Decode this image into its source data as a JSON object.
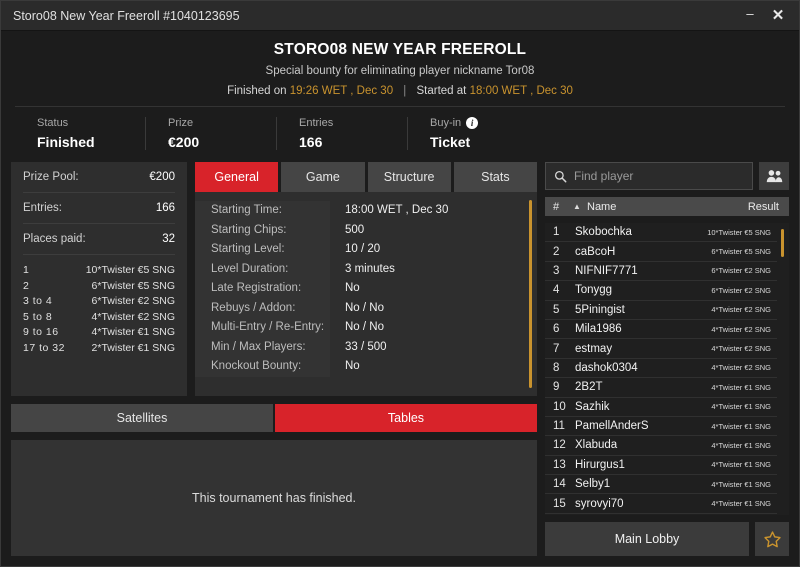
{
  "window": {
    "title": "Storo08 New Year Freeroll #1040123695",
    "minimize_label": "–",
    "close_label": "✕"
  },
  "header": {
    "title": "STORO08 NEW YEAR FREEROLL",
    "subtitle": "Special bounty for eliminating player nickname Tor08",
    "finished_label": "Finished on",
    "finished_value": "19:26 WET , Dec 30",
    "divider": "|",
    "started_label": "Started at",
    "started_value": "18:00 WET , Dec 30"
  },
  "stats": [
    {
      "label": "Status",
      "value": "Finished"
    },
    {
      "label": "Prize",
      "value": "€200"
    },
    {
      "label": "Entries",
      "value": "166"
    },
    {
      "label": "Buy-in",
      "value": "Ticket",
      "icon": "info-icon"
    }
  ],
  "prize_panel": {
    "rows": [
      {
        "label": "Prize Pool:",
        "value": "€200"
      },
      {
        "label": "Entries:",
        "value": "166"
      },
      {
        "label": "Places paid:",
        "value": "32"
      }
    ],
    "payouts": [
      {
        "place": "1",
        "prize": "10*Twister €5 SNG"
      },
      {
        "place": "2",
        "prize": "6*Twister €5 SNG"
      },
      {
        "place": "3  to  4",
        "prize": "6*Twister €2 SNG"
      },
      {
        "place": "5  to  8",
        "prize": "4*Twister €2 SNG"
      },
      {
        "place": "9  to  16",
        "prize": "4*Twister €1 SNG"
      },
      {
        "place": "17  to  32",
        "prize": "2*Twister €1 SNG"
      }
    ]
  },
  "tabs": [
    {
      "label": "General",
      "active": true
    },
    {
      "label": "Game",
      "active": false
    },
    {
      "label": "Structure",
      "active": false
    },
    {
      "label": "Stats",
      "active": false
    }
  ],
  "general_details": [
    {
      "label": "Starting Time:",
      "value": "18:00 WET , Dec 30"
    },
    {
      "label": "Starting Chips:",
      "value": "500"
    },
    {
      "label": "Starting Level:",
      "value": "10 / 20"
    },
    {
      "label": "Level Duration:",
      "value": "3 minutes"
    },
    {
      "label": "Late Registration:",
      "value": "No"
    },
    {
      "label": "Rebuys / Addon:",
      "value": "No / No"
    },
    {
      "label": "Multi-Entry / Re-Entry:",
      "value": "No / No"
    },
    {
      "label": "Min / Max Players:",
      "value": "33 / 500"
    },
    {
      "label": "Knockout Bounty:",
      "value": "No"
    }
  ],
  "lower_tabs": [
    {
      "label": "Satellites",
      "active": false
    },
    {
      "label": "Tables",
      "active": true
    }
  ],
  "lower_message": "This tournament has finished.",
  "search": {
    "placeholder": "Find player",
    "value": "",
    "icon": "search-icon",
    "people_icon": "people-icon"
  },
  "player_list": {
    "headers": {
      "num": "#",
      "sort": "▲",
      "name": "Name",
      "result": "Result"
    },
    "rows": [
      {
        "num": "1",
        "name": "Skobochka",
        "result": "10*Twister €5 SNG"
      },
      {
        "num": "2",
        "name": "caBcoH",
        "result": "6*Twister €5 SNG"
      },
      {
        "num": "3",
        "name": "NIFNIF7771",
        "result": "6*Twister €2 SNG"
      },
      {
        "num": "4",
        "name": "Tonygg",
        "result": "6*Twister €2 SNG"
      },
      {
        "num": "5",
        "name": "5Piningist",
        "result": "4*Twister €2 SNG"
      },
      {
        "num": "6",
        "name": "Mila1986",
        "result": "4*Twister €2 SNG"
      },
      {
        "num": "7",
        "name": "estmay",
        "result": "4*Twister €2 SNG"
      },
      {
        "num": "8",
        "name": "dashok0304",
        "result": "4*Twister €2 SNG"
      },
      {
        "num": "9",
        "name": "2B2T",
        "result": "4*Twister €1 SNG"
      },
      {
        "num": "10",
        "name": "Sazhik",
        "result": "4*Twister €1 SNG"
      },
      {
        "num": "11",
        "name": "PamellAnderS",
        "result": "4*Twister €1 SNG"
      },
      {
        "num": "12",
        "name": "Xlabuda",
        "result": "4*Twister €1 SNG"
      },
      {
        "num": "13",
        "name": "Hirurgus1",
        "result": "4*Twister €1 SNG"
      },
      {
        "num": "14",
        "name": "Selby1",
        "result": "4*Twister €1 SNG"
      },
      {
        "num": "15",
        "name": "syrovyi70",
        "result": "4*Twister €1 SNG"
      }
    ]
  },
  "footer": {
    "main_lobby_label": "Main Lobby",
    "star_icon": "star-icon"
  },
  "colors": {
    "accent_red": "#d8232a",
    "gold": "#c9932e",
    "panel": "#2e2e2e",
    "window_bg": "#1c1c1c"
  }
}
